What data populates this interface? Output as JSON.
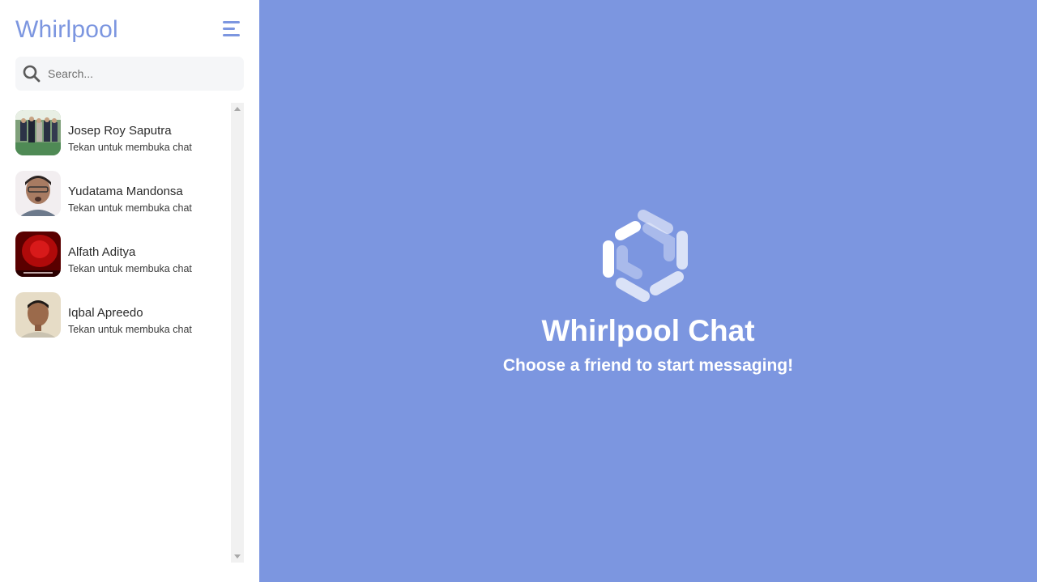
{
  "app": {
    "brand": "Whirlpool"
  },
  "colors": {
    "accent": "#7c96e0",
    "sidebar_bg": "#ffffff",
    "search_bg": "#f5f6f8"
  },
  "icons": {
    "menu": "hamburger-icon",
    "search": "search-icon",
    "logo": "whirlpool-logo"
  },
  "search": {
    "placeholder": "Search...",
    "value": ""
  },
  "contacts": [
    {
      "name": "Josep Roy Saputra",
      "subtitle": "Tekan untuk membuka chat"
    },
    {
      "name": "Yudatama Mandonsa",
      "subtitle": "Tekan untuk membuka chat"
    },
    {
      "name": "Alfath Aditya",
      "subtitle": "Tekan untuk membuka chat"
    },
    {
      "name": "Iqbal Apreedo",
      "subtitle": "Tekan untuk membuka chat"
    }
  ],
  "main": {
    "title": "Whirlpool Chat",
    "subtitle": "Choose a friend to start messaging!"
  }
}
